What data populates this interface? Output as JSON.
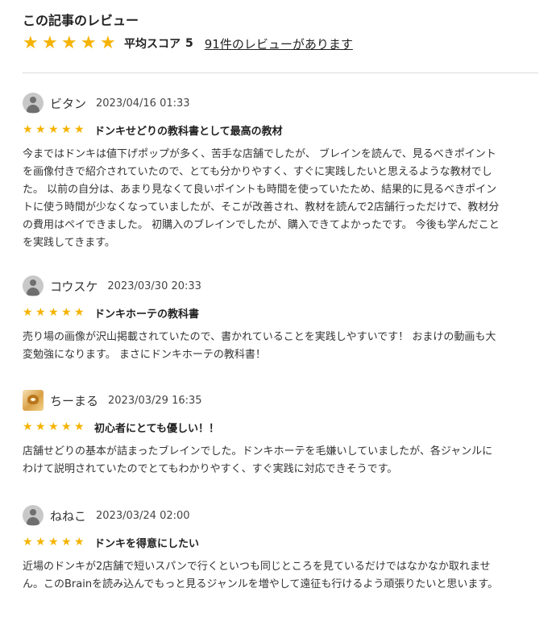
{
  "section": {
    "title": "この記事のレビュー",
    "avg_label": "平均スコア",
    "avg_score": "5",
    "review_count_link": "91件のレビューがあります",
    "star_glyph": "★",
    "star_color": "#f5b301"
  },
  "reviews": [
    {
      "name": "ビタン",
      "date": "2023/04/16 01:33",
      "rating": 5,
      "title": "ドンキせどりの教科書として最高の教材",
      "body": "今まではドンキは値下げポップが多く、苦手な店舗でしたが、 ブレインを読んで、見るべきポイント\nを画像付きで紹介されていたので、とても分かりやすく、すぐに実践したいと思えるような教材でし\nた。 以前の自分は、あまり見なくて良いポイントも時間を使っていたため、結果的に見るべきポイン\nトに使う時間が少なくなっていましたが、そこが改善され、教材を読んで2店舗行っただけで、教材分\nの費用はペイできました。 初購入のブレインでしたが、購入できてよかったです。 今後も学んだこと\nを実践してきます。"
    },
    {
      "name": "コウスケ",
      "date": "2023/03/30 20:33",
      "rating": 5,
      "title": "ドンキホーテの教科書",
      "body": "売り場の画像が沢山掲載されていたので、書かれていることを実践しやすいです！ おまけの動画も大\n変勉強になります。 まさにドンキホーテの教科書！"
    },
    {
      "name": "ちーまる",
      "date": "2023/03/29 16:35",
      "rating": 5,
      "title": "初心者にとても優しい！！",
      "body": "店舗せどりの基本が詰まったブレインでした。ドンキホーテを毛嫌いしていましたが、各ジャンルに\nわけて説明されていたのでとてもわかりやすく、すぐ実践に対応できそうです。"
    },
    {
      "name": "ねねこ",
      "date": "2023/03/24 02:00",
      "rating": 5,
      "title": "ドンキを得意にしたい",
      "body": "近場のドンキが2店舗で短いスパンで行くといつも同じところを見ているだけではなかなか取れませ\nん。このBrainを読み込んでもっと見るジャンルを増やして遠征も行けるよう頑張りたいと思います。"
    }
  ]
}
